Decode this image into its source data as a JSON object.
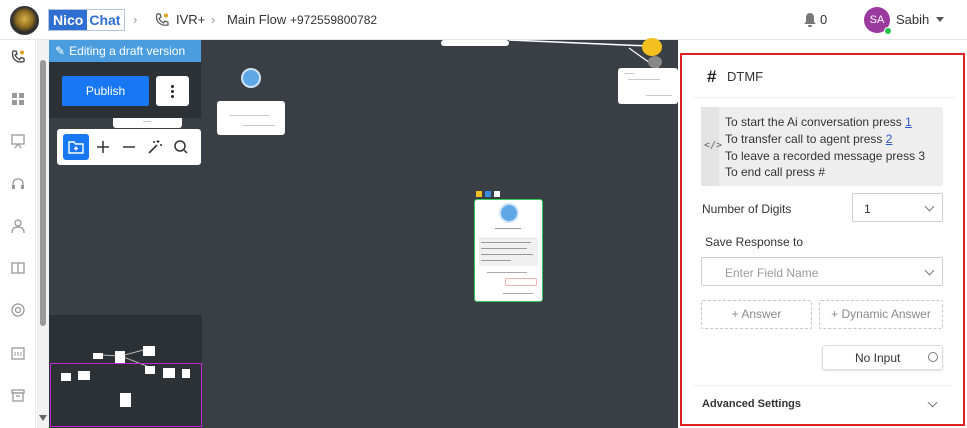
{
  "header": {
    "brand_part1": "Nico",
    "brand_part2": "Chat",
    "breadcrumb": [
      "IVR+",
      "Main Flow",
      "+972559800782"
    ],
    "notifications_count": "0",
    "user_initials": "SA",
    "user_name": "Sabih"
  },
  "canvas": {
    "draft_banner": "Editing a draft version",
    "publish_label": "Publish"
  },
  "panel": {
    "title": "DTMF",
    "message_lines": [
      {
        "text": "To start the Ai conversation press ",
        "link": "1"
      },
      {
        "text": "To transfer call to agent press ",
        "link": "2"
      },
      {
        "text": "To leave a recorded message press 3",
        "link": ""
      },
      {
        "text": "To end call press #",
        "link": ""
      }
    ],
    "num_digits_label": "Number of Digits",
    "num_digits_value": "1",
    "save_response_label": "Save Response to",
    "field_placeholder": "Enter Field Name",
    "add_answer_label": "+ Answer",
    "add_dynamic_answer_label": "+ Dynamic Answer",
    "no_input_label": "No Input",
    "advanced_settings_label": "Advanced Settings"
  },
  "colors": {
    "accent": "#1877f2",
    "banner": "#4a9ee0",
    "canvas": "#3a3f45",
    "highlight_frame": "#e02020",
    "minimap_view": "#c026d3"
  }
}
